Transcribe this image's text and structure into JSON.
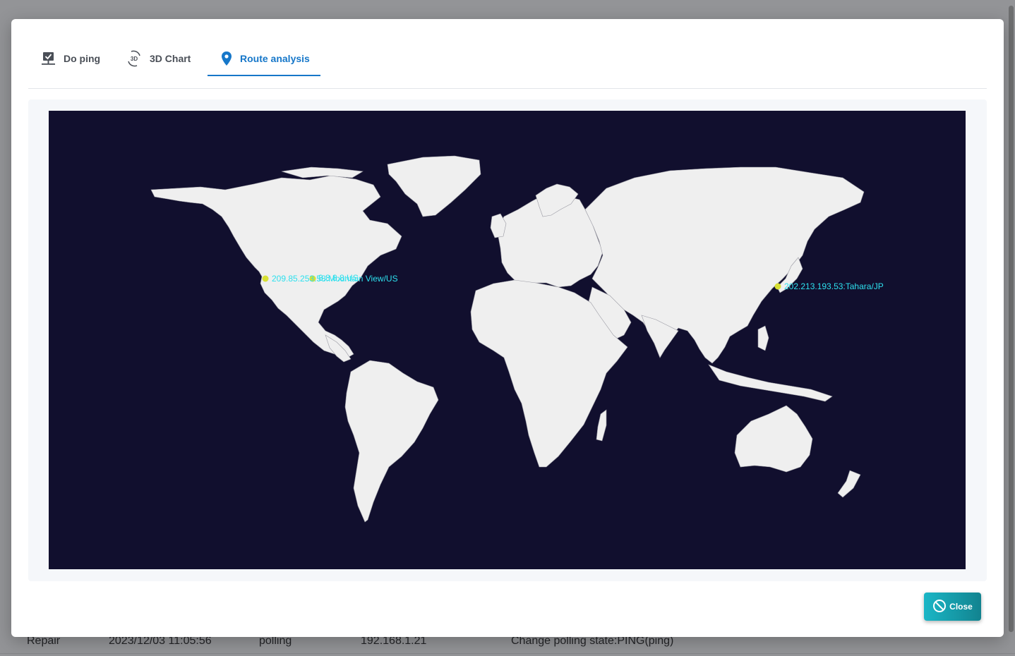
{
  "background": {
    "rows": [
      {
        "type": "Repair",
        "date": "2023/12/03 11:05:56",
        "event": "polling",
        "ip": "192.168.1.21",
        "message": "Change polling state:PING(ping)"
      }
    ]
  },
  "tabs": [
    {
      "label": "Do ping",
      "icon": "ping-monitor-icon",
      "active": false
    },
    {
      "label": "3D Chart",
      "icon": "3d-rotate-icon",
      "active": false
    },
    {
      "label": "Route analysis",
      "icon": "map-pin-icon",
      "active": true
    }
  ],
  "map": {
    "markers": [
      {
        "label": "209.85.253.58:Mountain View/US"
      },
      {
        "label": "8.8.8.8:US"
      },
      {
        "label": "202.213.193.53:Tahara/JP"
      }
    ],
    "colors": {
      "ocean": "#110f2e",
      "land": "#efefef",
      "marker": "#d8e033",
      "label": "#2de0ee"
    }
  },
  "footer": {
    "close_label": "Close",
    "close_icon": "ban-icon"
  }
}
